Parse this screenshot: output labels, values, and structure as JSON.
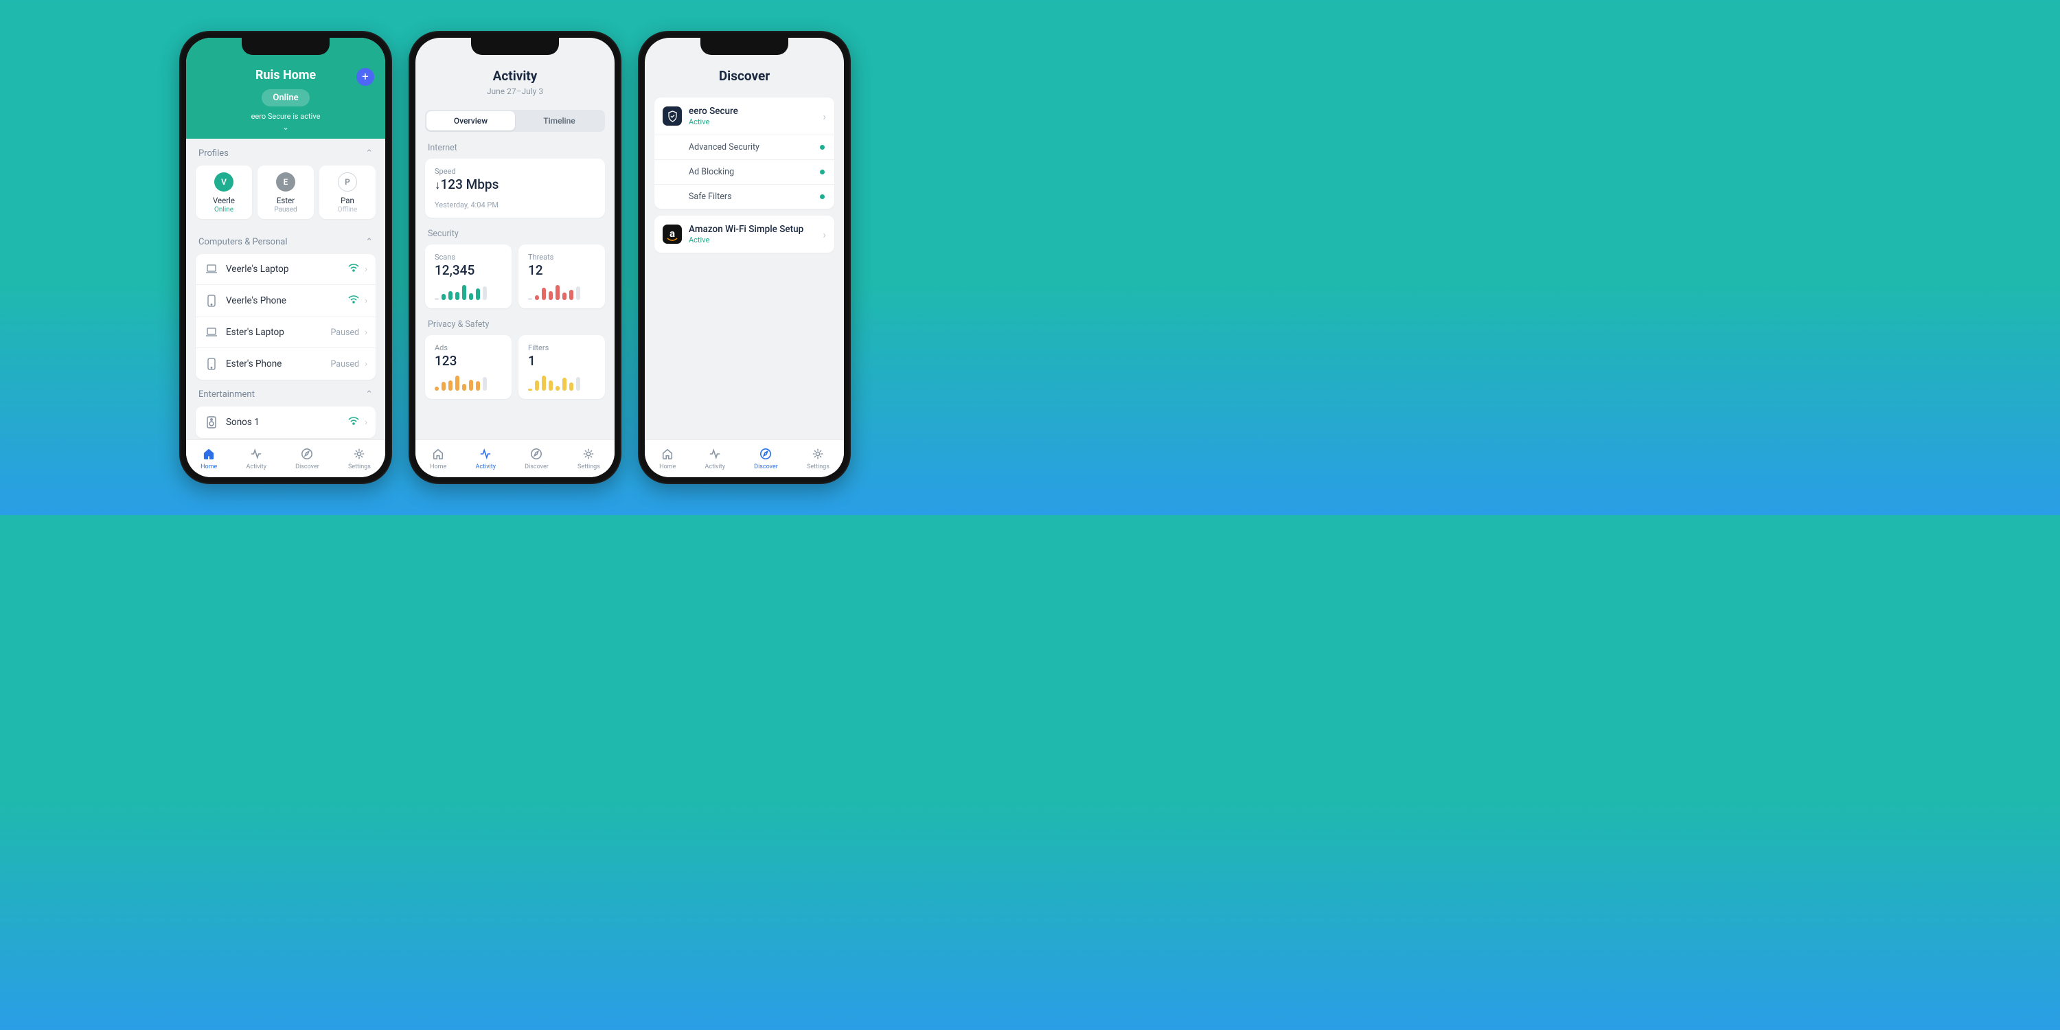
{
  "phones": {
    "home": {
      "title": "Ruis Home",
      "status_pill": "Online",
      "secure_text": "eero Secure is active",
      "profiles_head": "Profiles",
      "profiles": [
        {
          "initial": "V",
          "name": "Veerle",
          "status": "Online",
          "status_cls": "st-online",
          "avatar_cls": "green"
        },
        {
          "initial": "E",
          "name": "Ester",
          "status": "Paused",
          "status_cls": "st-paused",
          "avatar_cls": "grey"
        },
        {
          "initial": "P",
          "name": "Pan",
          "status": "Offline",
          "status_cls": "st-offline",
          "avatar_cls": "outline"
        }
      ],
      "comp_head": "Computers & Personal",
      "devices": [
        {
          "icon": "laptop",
          "name": "Veerle's Laptop",
          "right": "wifi"
        },
        {
          "icon": "phone",
          "name": "Veerle's Phone",
          "right": "wifi"
        },
        {
          "icon": "laptop",
          "name": "Ester's Laptop",
          "right": "Paused"
        },
        {
          "icon": "phone",
          "name": "Ester's Phone",
          "right": "Paused"
        }
      ],
      "ent_head": "Entertainment",
      "ent_first_device": "Sonos 1"
    },
    "activity": {
      "title": "Activity",
      "date_range": "June 27–July 3",
      "seg_overview": "Overview",
      "seg_timeline": "Timeline",
      "internet_label": "Internet",
      "speed_label": "Speed",
      "speed_value": "123 Mbps",
      "speed_time": "Yesterday, 4:04 PM",
      "security_label": "Security",
      "scans_label": "Scans",
      "scans_value": "12,345",
      "threats_label": "Threats",
      "threats_value": "12",
      "privacy_label": "Privacy & Safety",
      "ads_label": "Ads",
      "ads_value": "123",
      "filters_label": "Filters",
      "filters_value": "1"
    },
    "discover": {
      "title": "Discover",
      "eero_title": "eero Secure",
      "eero_status": "Active",
      "eero_subs": [
        "Advanced Security",
        "Ad Blocking",
        "Safe Filters"
      ],
      "amazon_title": "Amazon Wi-Fi Simple Setup",
      "amazon_status": "Active",
      "amazon_letter": "a"
    }
  },
  "tabs": {
    "home": "Home",
    "activity": "Activity",
    "discover": "Discover",
    "settings": "Settings"
  },
  "chart_data": [
    {
      "type": "bar",
      "title": "Scans",
      "value_label": "12,345",
      "series": [
        {
          "name": "scans",
          "values": [
            5,
            40,
            60,
            55,
            100,
            45,
            75
          ],
          "color": "#1fae8f"
        }
      ]
    },
    {
      "type": "bar",
      "title": "Threats",
      "value_label": "12",
      "series": [
        {
          "name": "threats",
          "values": [
            5,
            30,
            75,
            55,
            90,
            45,
            60
          ],
          "color": "#e46964"
        }
      ]
    },
    {
      "type": "bar",
      "title": "Ads",
      "value_label": "123",
      "series": [
        {
          "name": "ads",
          "values": [
            25,
            55,
            65,
            95,
            45,
            70,
            60
          ],
          "color": "#f0a84b"
        }
      ]
    },
    {
      "type": "bar",
      "title": "Filters",
      "value_label": "1",
      "series": [
        {
          "name": "filters",
          "values": [
            10,
            55,
            80,
            55,
            25,
            70,
            45
          ],
          "color": "#f2c94c"
        }
      ]
    }
  ]
}
